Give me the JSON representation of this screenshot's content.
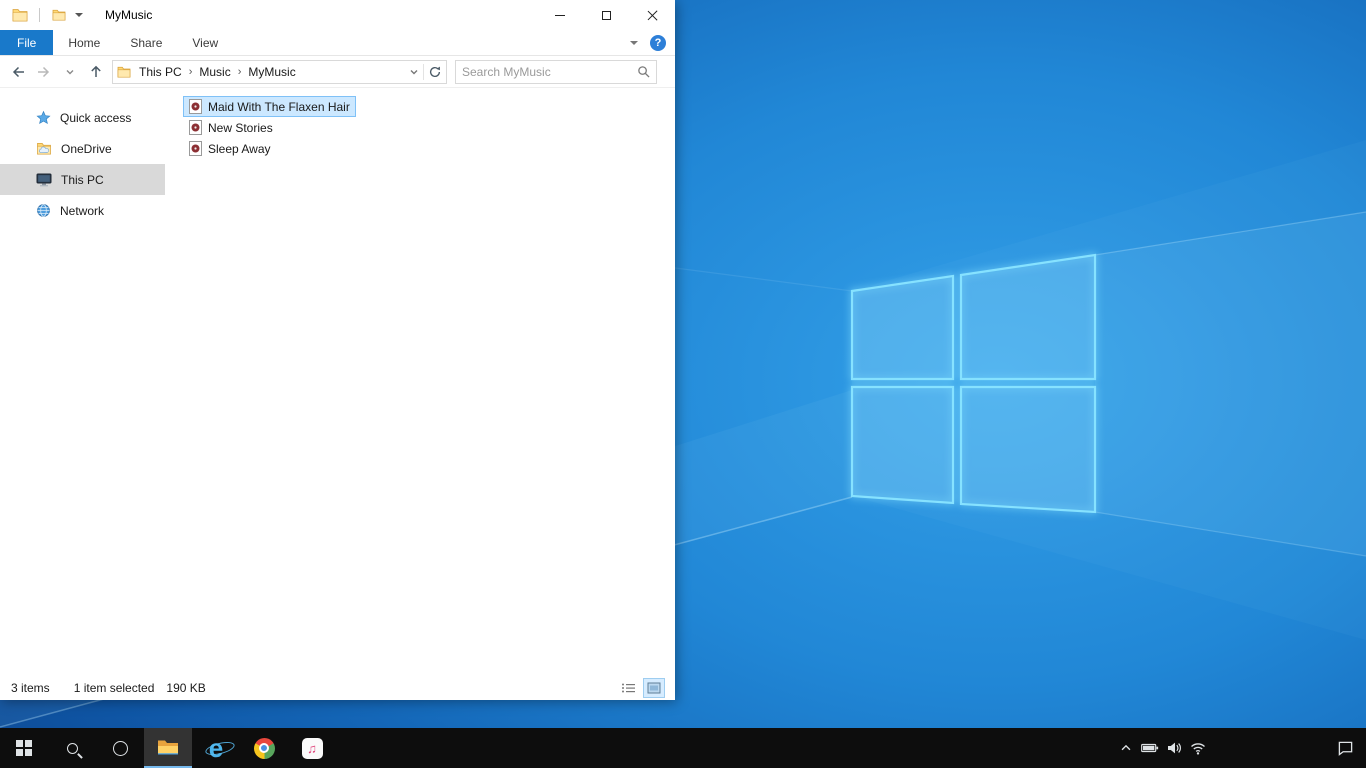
{
  "window": {
    "title": "MyMusic",
    "tabs": {
      "file": "File",
      "home": "Home",
      "share": "Share",
      "view": "View"
    },
    "breadcrumbs": {
      "root": "This PC",
      "parent": "Music",
      "current": "MyMusic"
    },
    "search_placeholder": "Search MyMusic",
    "sidebar": {
      "quick_access": "Quick access",
      "onedrive": "OneDrive",
      "this_pc": "This PC",
      "network": "Network"
    },
    "files": [
      "Maid With The Flaxen Hair",
      "New Stories",
      "Sleep Away"
    ],
    "status": {
      "count": "3 items",
      "selected": "1 item selected",
      "size": "190 KB"
    }
  },
  "glyphs": {
    "breadcrumb_separator": "›",
    "help": "?",
    "ie": "e",
    "itunes_note": "♫"
  },
  "colors": {
    "accent": "#1979ca",
    "selection_fill": "#cce8ff",
    "selection_border": "#7fc1f7",
    "sidebar_selected": "#d9d9d9",
    "taskbar": "#0d0d0d"
  }
}
